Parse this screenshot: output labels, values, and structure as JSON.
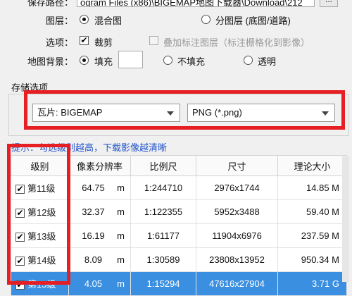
{
  "top": {
    "save_path_label": "保存路径：",
    "save_path_value": "ogram Files (x86)\\BIGEMAP地图下载器\\Download\\212",
    "browse_label": "..."
  },
  "layer": {
    "label": "图层：",
    "opt_mixed": "混合图",
    "opt_split": "分图层 (底图/道路)"
  },
  "options": {
    "label": "选项：",
    "crop": "裁剪",
    "overlay": "叠加标注图层（标注栅格化到影像）"
  },
  "background": {
    "label": "地图背景：",
    "fill": "填充",
    "no_fill": "不填充",
    "transparent": "透明"
  },
  "storage": {
    "section_label": "存储选项",
    "tile_value": "瓦片: BIGEMAP",
    "format_value": "PNG (*.png)"
  },
  "hint": "提示：勾选级别越高，下载影像越清晰",
  "table": {
    "headers": [
      "级别",
      "像素分辨率",
      "比例尺",
      "尺寸",
      "理论大小"
    ],
    "rows": [
      {
        "level": "第11级",
        "res": "64.75",
        "unit": "m",
        "scale": "1:244710",
        "size": "2976x1744",
        "theory": "14.85 M"
      },
      {
        "level": "第12级",
        "res": "32.37",
        "unit": "m",
        "scale": "1:122355",
        "size": "5952x3488",
        "theory": "59.40 M"
      },
      {
        "level": "第13级",
        "res": "16.19",
        "unit": "m",
        "scale": "1:61177",
        "size": "11904x6976",
        "theory": "237.59 M"
      },
      {
        "level": "第14级",
        "res": "8.09",
        "unit": "m",
        "scale": "1:30589",
        "size": "23808x13952",
        "theory": "950.34 M"
      },
      {
        "level": "第15级",
        "res": "4.05",
        "unit": "m",
        "scale": "1:15294",
        "size": "47616x27904",
        "theory": "3.71 G"
      }
    ]
  },
  "colors": {
    "highlight_box": "#e51f24",
    "selected_row": "#3b8fe0"
  }
}
